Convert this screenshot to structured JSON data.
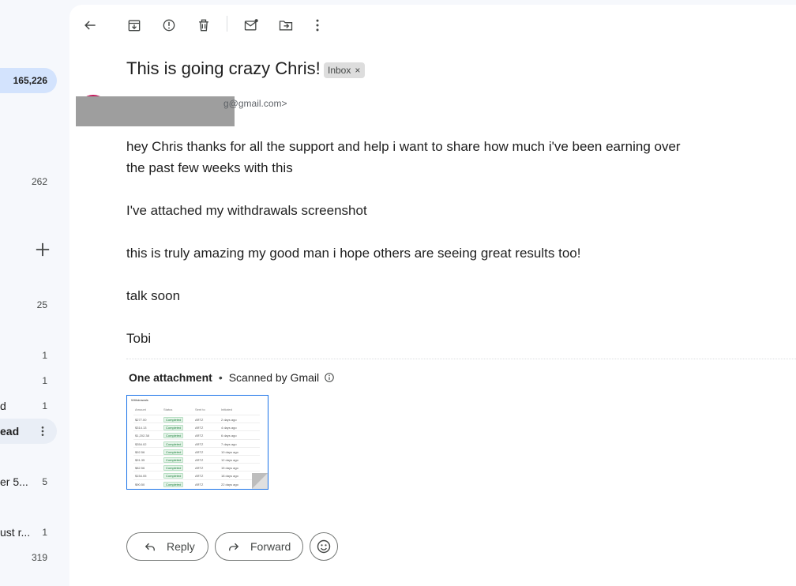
{
  "sidebar": {
    "rows": [
      {
        "label": "",
        "count": "165,226"
      },
      {
        "label": "",
        "count": "262"
      },
      {
        "label": "",
        "count": "25"
      },
      {
        "label": "",
        "count": "1"
      },
      {
        "label": "",
        "count": "1"
      },
      {
        "label": "d",
        "count": "1"
      },
      {
        "label": "ead",
        "count": ""
      },
      {
        "label": "er 5...",
        "count": "5"
      },
      {
        "label": "ust r...",
        "count": "1"
      },
      {
        "label": "",
        "count": "319"
      }
    ]
  },
  "toolbar": {
    "icons": [
      "back-icon",
      "archive-icon",
      "report-spam-icon",
      "delete-icon",
      "mark-unread-icon",
      "move-to-icon",
      "more-icon"
    ]
  },
  "email": {
    "subject": "This is going crazy Chris!",
    "label": "Inbox",
    "label_remove": "×",
    "sender_email": "g@gmail.com>",
    "body": [
      "hey Chris thanks for all the support and help i want to share how much i've been earning over the past few weeks with this",
      "I've attached my withdrawals screenshot",
      "this is truly amazing my good man i hope others are seeing great results too!",
      "talk soon",
      "Tobi"
    ]
  },
  "attachments": {
    "count_label": "One attachment",
    "separator": "•",
    "scan_label": "Scanned by Gmail",
    "thumbnail": {
      "title": "Withdrawals",
      "headers": [
        "Amount",
        "Status",
        "Sent to",
        "Initiated"
      ],
      "rows": [
        [
          "$277.00",
          "Completed",
          "ARTZ",
          "2 days ago"
        ],
        [
          "$314.13",
          "Completed",
          "ARTZ",
          "4 days ago"
        ],
        [
          "$1,202.38",
          "Completed",
          "ARTZ",
          "6 days ago"
        ],
        [
          "$354.02",
          "Completed",
          "ARTZ",
          "7 days ago"
        ],
        [
          "$92.56",
          "Completed",
          "ARTZ",
          "10 days ago"
        ],
        [
          "$91.35",
          "Completed",
          "ARTZ",
          "12 days ago"
        ],
        [
          "$82.56",
          "Completed",
          "ARTZ",
          "15 days ago"
        ],
        [
          "$154.05",
          "Completed",
          "ARTZ",
          "18 days ago"
        ],
        [
          "$90.50",
          "Completed",
          "ARTZ",
          "22 days ago"
        ]
      ]
    }
  },
  "actions": {
    "reply": "Reply",
    "forward": "Forward"
  },
  "colors": {
    "accent": "#1a73e8",
    "active_bg": "#d3e3fd",
    "avatar": "#c2185b"
  }
}
